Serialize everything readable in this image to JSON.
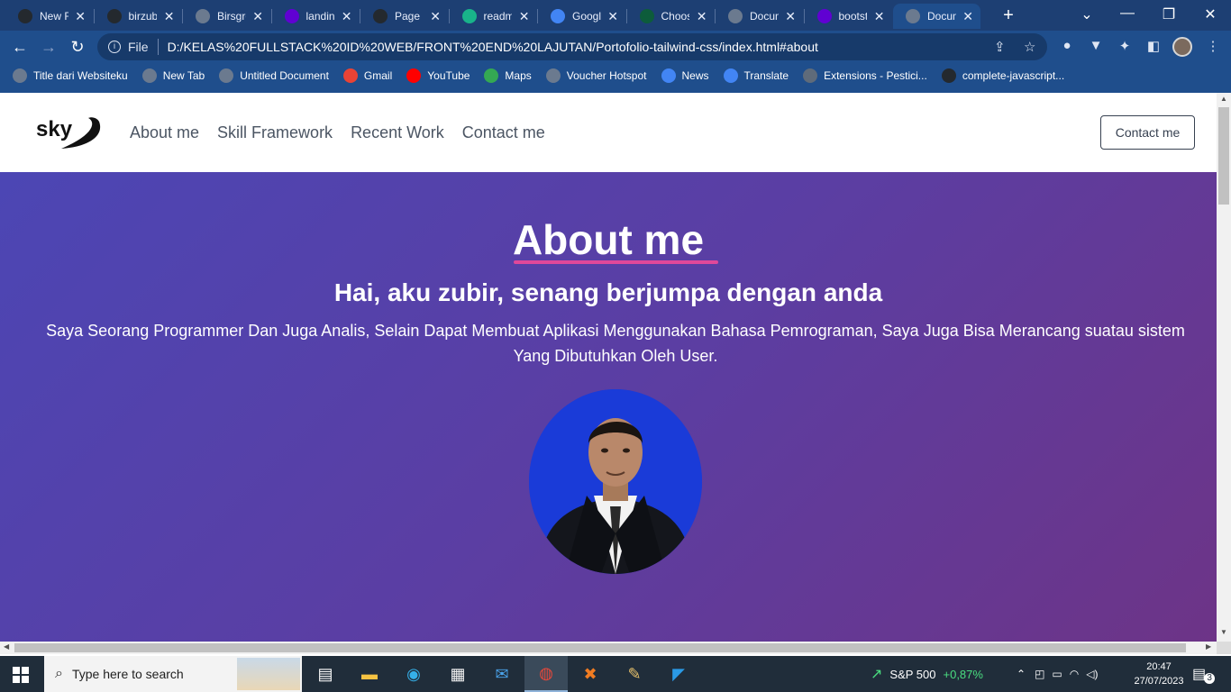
{
  "browser": {
    "tabs": [
      {
        "title": "New Fi",
        "icon": "github-icon",
        "color": "#24292e"
      },
      {
        "title": "birzub",
        "icon": "github-icon",
        "color": "#24292e"
      },
      {
        "title": "Birsgro",
        "icon": "globe-icon",
        "color": "#6b7a8f"
      },
      {
        "title": "landing",
        "icon": "yahoo-icon",
        "color": "#6001d2"
      },
      {
        "title": "Page n",
        "icon": "github-icon",
        "color": "#24292e"
      },
      {
        "title": "readm",
        "icon": "readme-icon",
        "color": "#19b38a"
      },
      {
        "title": "Google",
        "icon": "translate-icon",
        "color": "#4285f4"
      },
      {
        "title": "Choos",
        "icon": "w-icon",
        "color": "#0d5c3b"
      },
      {
        "title": "Docum",
        "icon": "globe-icon",
        "color": "#6b7a8f"
      },
      {
        "title": "bootst",
        "icon": "yahoo-icon",
        "color": "#6001d2"
      },
      {
        "title": "Docum",
        "icon": "globe-icon",
        "color": "#6b7a8f"
      }
    ],
    "new_tab_label": "+",
    "url_scheme": "File",
    "url": "D:/KELAS%20FULLSTACK%20ID%20WEB/FRONT%20END%20LAJUTAN/Portofolio-tailwind-css/index.html#about",
    "bookmarks": [
      {
        "label": "Title dari Websiteku",
        "icon": "globe-icon",
        "color": "#6b7a8f"
      },
      {
        "label": "New Tab",
        "icon": "globe-icon",
        "color": "#6b7a8f"
      },
      {
        "label": "Untitled Document",
        "icon": "globe-icon",
        "color": "#6b7a8f"
      },
      {
        "label": "Gmail",
        "icon": "gmail-icon",
        "color": "#ea4335"
      },
      {
        "label": "YouTube",
        "icon": "youtube-icon",
        "color": "#ff0000"
      },
      {
        "label": "Maps",
        "icon": "maps-icon",
        "color": "#34a853"
      },
      {
        "label": "Voucher Hotspot",
        "icon": "globe-icon",
        "color": "#6b7a8f"
      },
      {
        "label": "News",
        "icon": "news-icon",
        "color": "#4285f4"
      },
      {
        "label": "Translate",
        "icon": "translate-icon",
        "color": "#4285f4"
      },
      {
        "label": "Extensions - Pestici...",
        "icon": "puzzle-icon",
        "color": "#5f6b7a"
      },
      {
        "label": "complete-javascript...",
        "icon": "github-icon",
        "color": "#24292e"
      }
    ]
  },
  "site": {
    "logo_text": "sky",
    "nav": [
      "About me",
      "Skill Framework",
      "Recent Work",
      "Contact me"
    ],
    "cta": "Contact me",
    "hero": {
      "title": "About me",
      "subtitle": "Hai, aku zubir, senang berjumpa dengan anda",
      "body": "Saya Seorang Programmer Dan Juga Analis, Selain Dapat Membuat Aplikasi Menggunakan Bahasa Pemrograman, Saya Juga Bisa Merancang suatau sistem Yang Dibutuhkan Oleh User."
    }
  },
  "taskbar": {
    "search_placeholder": "Type here to search",
    "stock_name": "S&P 500",
    "stock_change": "+0,87%",
    "time": "20:47",
    "date": "27/07/2023",
    "notification_count": "3"
  },
  "colors": {
    "accent_underline": "#e0489a",
    "stock_up": "#4ade80"
  }
}
